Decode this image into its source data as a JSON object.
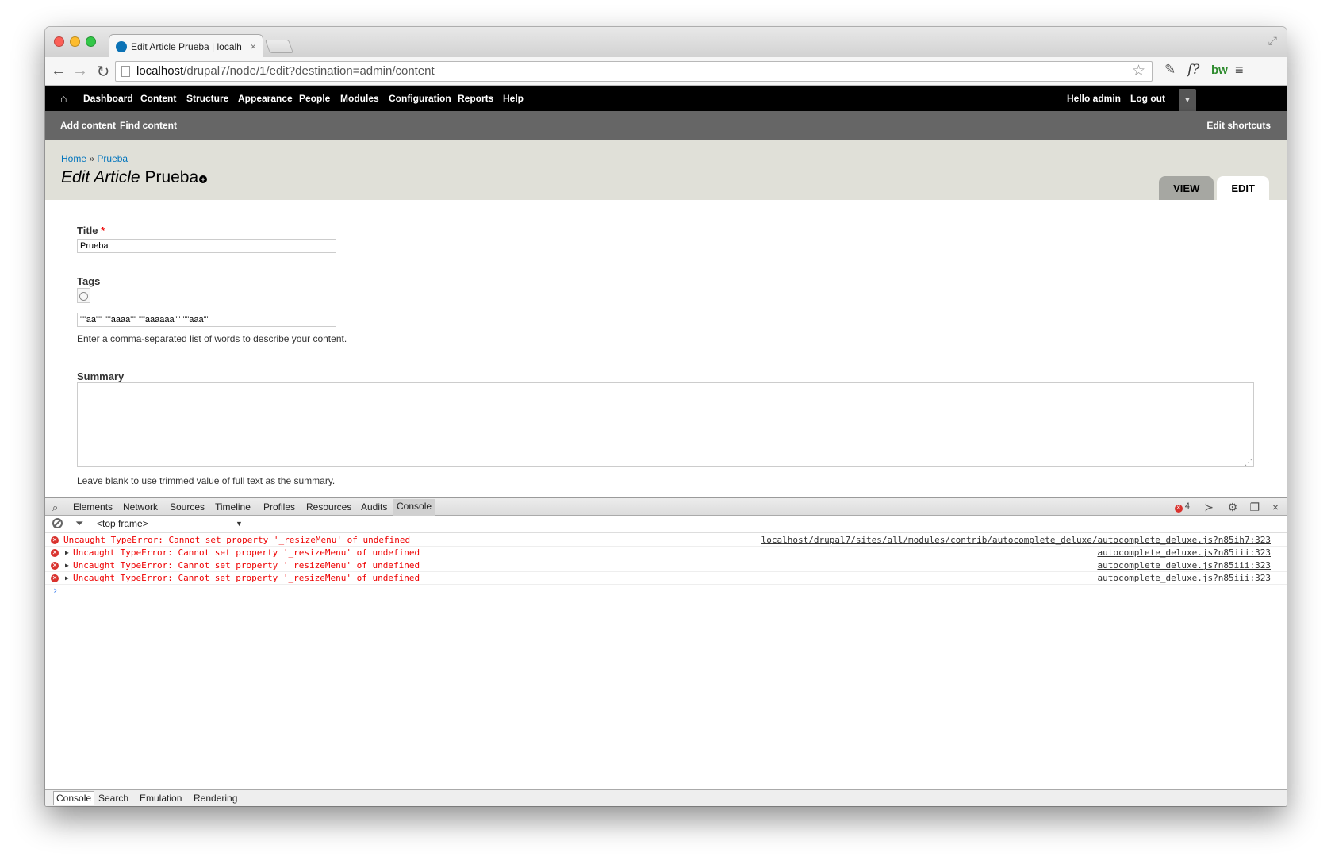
{
  "browser": {
    "tab_title": "Edit Article Prueba | localh",
    "tab_close": "×",
    "url_host": "localhost",
    "url_path": "/drupal7/node/1/edit?destination=admin/content",
    "ext_fx": "f?",
    "ext_bw": "bw"
  },
  "admin_menu": {
    "items": [
      "Dashboard",
      "Content",
      "Structure",
      "Appearance",
      "People",
      "Modules",
      "Configuration",
      "Reports",
      "Help"
    ],
    "hello": "Hello admin",
    "logout": "Log out"
  },
  "shortcuts": {
    "add_content": "Add content",
    "find_content": "Find content",
    "edit_shortcuts": "Edit shortcuts"
  },
  "page": {
    "breadcrumb_home": "Home",
    "breadcrumb_sep": "»",
    "breadcrumb_current": "Prueba",
    "title_em": "Edit Article",
    "title_rest": "Prueba",
    "tab_view": "View",
    "tab_edit": "Edit"
  },
  "form": {
    "title_label": "Title",
    "required_mark": "*",
    "title_value": "Prueba",
    "tags_label": "Tags",
    "tags_value": "\"\"aa\"\" \"\"aaaa\"\" \"\"aaaaaa\"\" \"\"aaa\"\"",
    "tags_description": "Enter a comma-separated list of words to describe your content.",
    "summary_label": "Summary",
    "summary_value": "",
    "summary_description": "Leave blank to use trimmed value of full text as the summary."
  },
  "devtools": {
    "tabs": [
      "Elements",
      "Network",
      "Sources",
      "Timeline",
      "Profiles",
      "Resources",
      "Audits",
      "Console"
    ],
    "active_tab": "Console",
    "error_count": "4",
    "frame": "<top frame>",
    "errors": [
      {
        "message": "Uncaught TypeError: Cannot set property '_resizeMenu' of undefined",
        "source": "localhost/drupal7/sites/all/modules/contrib/autocomplete_deluxe/autocomplete_deluxe.js?n85ih7:323",
        "expandable": false
      },
      {
        "message": "Uncaught TypeError: Cannot set property '_resizeMenu' of undefined",
        "source": "autocomplete_deluxe.js?n85iii:323",
        "expandable": true
      },
      {
        "message": "Uncaught TypeError: Cannot set property '_resizeMenu' of undefined",
        "source": "autocomplete_deluxe.js?n85iii:323",
        "expandable": true
      },
      {
        "message": "Uncaught TypeError: Cannot set property '_resizeMenu' of undefined",
        "source": "autocomplete_deluxe.js?n85iii:323",
        "expandable": true
      }
    ],
    "prompt": "›",
    "drawer_tabs": [
      "Console",
      "Search",
      "Emulation",
      "Rendering"
    ]
  }
}
